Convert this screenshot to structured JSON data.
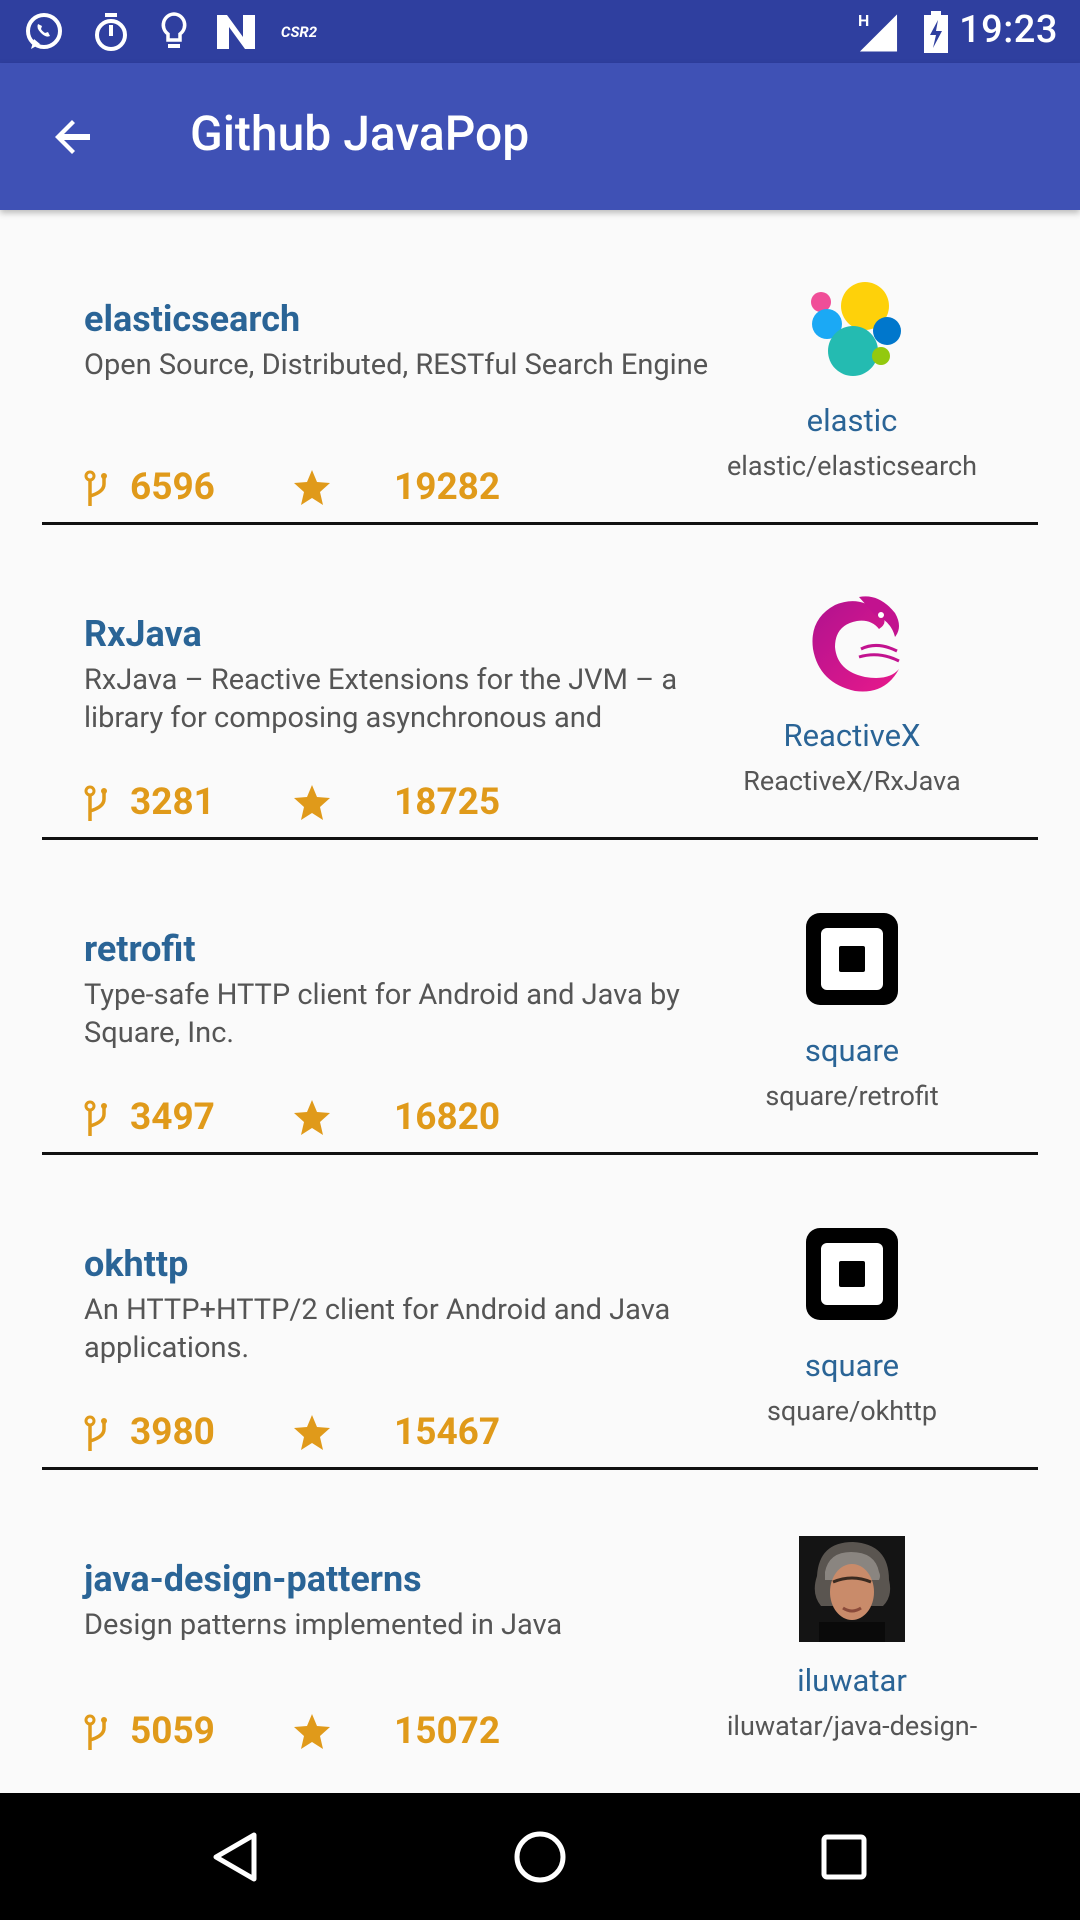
{
  "status_bar": {
    "time": "19:23",
    "icons": [
      "whatsapp-icon",
      "timer-icon",
      "lightbulb-icon",
      "n-app-icon",
      "csr2-icon",
      "signal-h-icon",
      "battery-charging-icon"
    ],
    "csr2_label": "CSR2",
    "network_label": "H"
  },
  "app_bar": {
    "title": "Github JavaPop",
    "back_icon": "arrow-back-icon"
  },
  "colors": {
    "status_bar": "#2f3f9f",
    "app_bar": "#3f51b5",
    "repo_name": "#2a6496",
    "stats": "#e09a1a",
    "description": "#555555",
    "divider": "#111111"
  },
  "repos": [
    {
      "name": "elasticsearch",
      "description": "Open Source, Distributed, RESTful Search Engine",
      "forks": "6596",
      "stars": "19282",
      "owner_login": "elastic",
      "owner_full": "elastic/elasticsearch",
      "avatar": "elastic-logo"
    },
    {
      "name": "RxJava",
      "description": "RxJava – Reactive Extensions for the JVM – a library for composing asynchronous and",
      "forks": "3281",
      "stars": "18725",
      "owner_login": "ReactiveX",
      "owner_full": "ReactiveX/RxJava",
      "avatar": "reactivex-logo"
    },
    {
      "name": "retrofit",
      "description": "Type-safe HTTP client for Android and Java by Square, Inc.",
      "forks": "3497",
      "stars": "16820",
      "owner_login": "square",
      "owner_full": "square/retrofit",
      "avatar": "square-logo"
    },
    {
      "name": "okhttp",
      "description": "An HTTP+HTTP/2 client for Android and Java applications.",
      "forks": "3980",
      "stars": "15467",
      "owner_login": "square",
      "owner_full": "square/okhttp",
      "avatar": "square-logo"
    },
    {
      "name": "java-design-patterns",
      "description": "Design patterns implemented in Java",
      "forks": "5059",
      "stars": "15072",
      "owner_login": "iluwatar",
      "owner_full": "iluwatar/java-design-",
      "avatar": "user-photo"
    }
  ],
  "nav_bar": {
    "buttons": [
      "back-triangle-icon",
      "home-circle-icon",
      "recents-square-icon"
    ]
  }
}
